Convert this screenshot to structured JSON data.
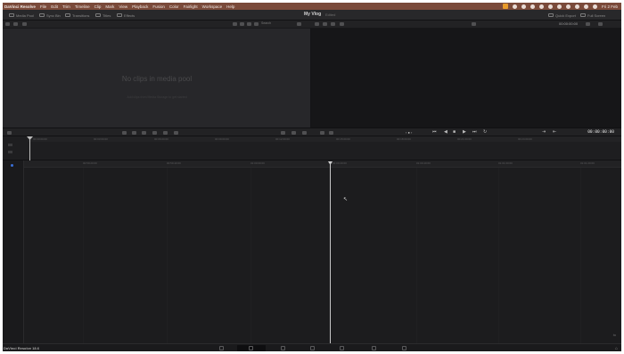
{
  "menubar": {
    "app_name": "DaVinci Resolve",
    "items": [
      "File",
      "Edit",
      "Trim",
      "Timeline",
      "Clip",
      "Mark",
      "View",
      "Playback",
      "Fusion",
      "Color",
      "Fairlight",
      "Workspace",
      "Help"
    ],
    "clock": "Fri 2 Feb"
  },
  "toolbar": {
    "media_pool_label": "Media Pool",
    "sync_bin_label": "Sync Bin",
    "transitions_label": "Transitions",
    "titles_label": "Titles",
    "effects_label": "Effects",
    "project_title": "My Vlog",
    "project_status": "Edited",
    "quick_export_label": "Quick Export",
    "full_screen_label": "Full Screen"
  },
  "media_pool": {
    "search_label": "Search",
    "empty_title": "No clips in media pool",
    "empty_hint": "Add clips from Media Storage to get started"
  },
  "viewer": {
    "zoom": "00:00:00:00"
  },
  "transport": {
    "timecode": "00:00:00:00"
  },
  "timeline": {
    "upper_ruler": [
      "00:00:00:00",
      "00:03:00:00",
      "00:06:00:00",
      "00:09:00:00",
      "00:12:00:00",
      "00:15:00:00",
      "00:18:00:00",
      "00:21:00:00",
      "00:24:00:00"
    ],
    "lower_ruler": [
      "00:59:20:00",
      "00:59:40:00",
      "01:00:00:00",
      "01:00:20:00",
      "01:00:40:00",
      "01:01:00:00",
      "01:01:20:00",
      "01:01:40:00"
    ]
  },
  "pagebar": {
    "version": "DaVinci Resolve 18.6"
  }
}
